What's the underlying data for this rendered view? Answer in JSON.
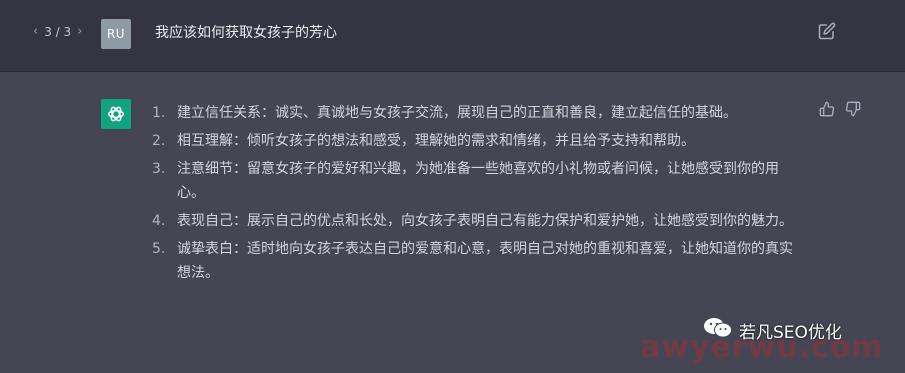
{
  "pager": {
    "prev": "‹",
    "label": "3 / 3",
    "next": "›"
  },
  "user": {
    "initials": "RU",
    "question": "我应该如何获取女孩子的芳心"
  },
  "answer": {
    "items": [
      {
        "num": "1.",
        "text": "建立信任关系：诚实、真诚地与女孩子交流，展现自己的正直和善良，建立起信任的基础。"
      },
      {
        "num": "2.",
        "text": "相互理解：倾听女孩子的想法和感受，理解她的需求和情绪，并且给予支持和帮助。"
      },
      {
        "num": "3.",
        "text": "注意细节：留意女孩子的爱好和兴趣，为她准备一些她喜欢的小礼物或者问候，让她感受到你的用心。"
      },
      {
        "num": "4.",
        "text": "表现自己：展示自己的优点和长处，向女孩子表明自己有能力保护和爱护她，让她感受到你的魅力。"
      },
      {
        "num": "5.",
        "text": "诚挚表白：适时地向女孩子表达自己的爱意和心意，表明自己对她的重视和喜爱，让她知道你的真实想法。"
      }
    ]
  },
  "watermark": {
    "label": "若凡SEO优化",
    "bg_text": "awyerwu.com"
  },
  "colors": {
    "user_bg": "#343541",
    "answer_bg": "#444654",
    "gpt_green": "#10a37f"
  }
}
